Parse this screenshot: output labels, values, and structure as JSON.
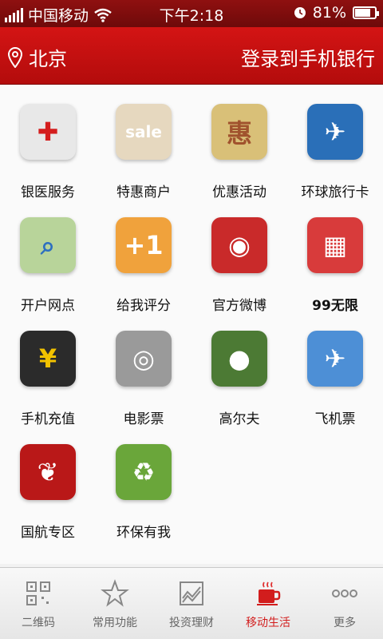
{
  "status": {
    "carrier": "中国移动",
    "time": "下午2:18",
    "battery": "81%",
    "battery_level": 0.81
  },
  "header": {
    "city": "北京",
    "login": "登录到手机银行"
  },
  "tiles": [
    {
      "label": "银医服务",
      "icon": "medical-kit-icon",
      "color": "#e8e8e8"
    },
    {
      "label": "特惠商户",
      "icon": "sale-shop-icon",
      "color": "#e6d8bf"
    },
    {
      "label": "优惠活动",
      "icon": "discount-bag-icon",
      "color": "#d9c078"
    },
    {
      "label": "环球旅行卡",
      "icon": "globe-card-icon",
      "color": "#2a6fb8"
    },
    {
      "label": "开户网点",
      "icon": "map-search-icon",
      "color": "#b8d49a"
    },
    {
      "label": "给我评分",
      "icon": "thumbs-up-icon",
      "color": "#f0a23c"
    },
    {
      "label": "官方微博",
      "icon": "weibo-icon",
      "color": "#c92a2a"
    },
    {
      "label": "99无限",
      "icon": "store-awning-icon",
      "color": "#d83b3b"
    },
    {
      "label": "手机充值",
      "icon": "phone-icon",
      "color": "#2b2b2b"
    },
    {
      "label": "电影票",
      "icon": "film-reel-icon",
      "color": "#9a9a9a"
    },
    {
      "label": "高尔夫",
      "icon": "golf-ball-icon",
      "color": "#4c7a34"
    },
    {
      "label": "飞机票",
      "icon": "airplane-icon",
      "color": "#4d8fd6"
    },
    {
      "label": "国航专区",
      "icon": "air-china-logo-icon",
      "color": "#b91818"
    },
    {
      "label": "环保有我",
      "icon": "recycle-icon",
      "color": "#6aa63a"
    }
  ],
  "tabs": [
    {
      "label": "二维码",
      "icon": "qr-code-icon"
    },
    {
      "label": "常用功能",
      "icon": "star-icon"
    },
    {
      "label": "投资理财",
      "icon": "chart-icon"
    },
    {
      "label": "移动生活",
      "icon": "coffee-cup-icon",
      "active": true
    },
    {
      "label": "更多",
      "icon": "more-dots-icon"
    }
  ]
}
